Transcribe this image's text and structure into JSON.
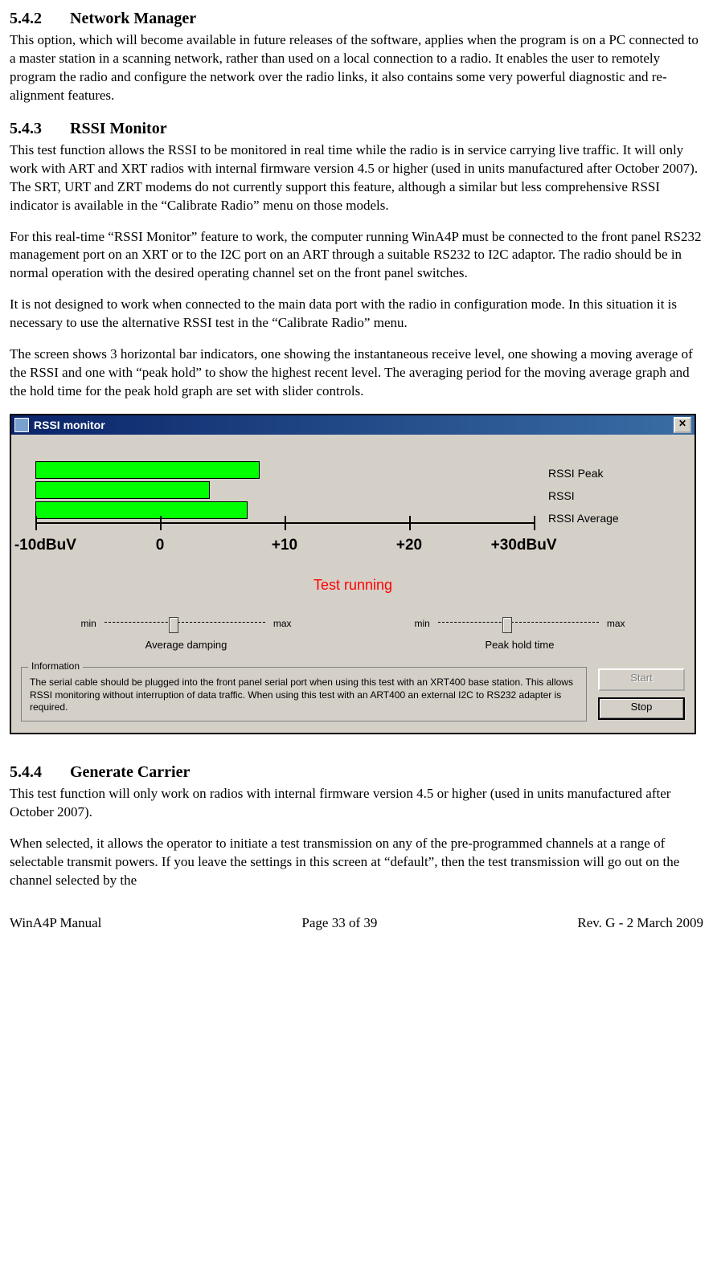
{
  "sections": {
    "s542": {
      "num": "5.4.2",
      "title": "Network Manager",
      "body": "This option, which will become available in future releases of the software, applies when the program is on a PC connected to a master station in a scanning network, rather than used on a local connection to a radio.  It enables the user to remotely program the radio and configure the network over the radio links, it also contains some very powerful diagnostic and re-alignment features."
    },
    "s543": {
      "num": "5.4.3",
      "title": "RSSI Monitor",
      "p1": "This test function allows the RSSI to be monitored in real time while the radio is in service carrying live traffic.  It will only work with ART and XRT radios with internal firmware version 4.5 or higher (used in units manufactured after October 2007).  The SRT, URT and ZRT modems do not currently support this feature, although a similar but less comprehensive RSSI indicator is available in the “Calibrate Radio” menu on those models.",
      "p2": "For this real-time “RSSI Monitor” feature to work, the computer running WinA4P must be connected to the front panel RS232 management port on an XRT or to the I2C port on an ART through a suitable RS232 to I2C adaptor.  The radio should be in normal operation with the desired  operating channel set on the front panel switches.",
      "p3": "It is not designed to work when connected to the main data port with the radio in configuration mode.  In this situation it is necessary to use the alternative RSSI test in the “Calibrate Radio” menu.",
      "p4": "The screen shows 3 horizontal bar indicators, one showing the instantaneous receive level, one showing a moving average of the RSSI and one with “peak hold” to show the highest recent level.  The averaging period for the moving average graph and the hold time for the peak hold graph are set with slider controls."
    },
    "s544": {
      "num": "5.4.4",
      "title": "Generate Carrier",
      "p1": "This test function will only work on radios with internal firmware version 4.5 or higher (used in units manufactured after October 2007).",
      "p2": "When selected, it allows the operator to initiate a test transmission on any of the pre-programmed channels at a range of selectable transmit powers.  If you leave the settings in this screen at “default”, then the test transmission will go out on the channel selected by the"
    }
  },
  "dialog": {
    "title": "RSSI monitor",
    "close_glyph": "✕",
    "legend": {
      "peak": "RSSI Peak",
      "rssi": "RSSI",
      "avg": "RSSI Average"
    },
    "status": "Test running",
    "slider1": {
      "min": "min",
      "max": "max",
      "caption": "Average damping"
    },
    "slider2": {
      "min": "min",
      "max": "max",
      "caption": "Peak hold time"
    },
    "info_legend": "Information",
    "info_text": "The serial cable should be plugged into the front panel serial port when using this test with an XRT400 base station. This allows RSSI monitoring without interruption of data traffic. When using this test with an ART400 an external I2C to RS232 adapter is required.",
    "start": "Start",
    "stop": "Stop",
    "ticks": {
      "t0": "-10dBuV",
      "t1": "0",
      "t2": "+10",
      "t3": "+20",
      "t4": "+30dBuV"
    }
  },
  "chart_data": {
    "type": "bar",
    "orientation": "horizontal",
    "categories": [
      "RSSI Peak",
      "RSSI",
      "RSSI Average"
    ],
    "values": [
      8,
      4,
      7
    ],
    "xlabel": "dBuV",
    "xlim": [
      -10,
      30
    ],
    "xticks": [
      -10,
      0,
      10,
      20,
      30
    ],
    "title": "RSSI monitor"
  },
  "footer": {
    "left": "WinA4P Manual",
    "center": "Page 33 of 39",
    "right": "Rev. G -  2 March 2009"
  }
}
